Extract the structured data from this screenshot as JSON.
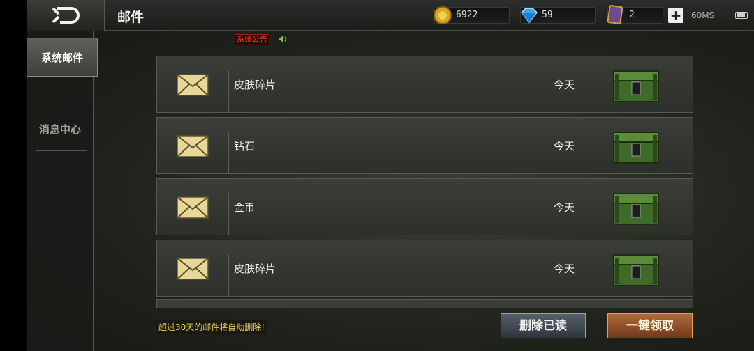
{
  "header": {
    "title": "邮件",
    "gold": "6922",
    "diamond": "59",
    "card": "2",
    "plus": "+",
    "network": "60MS"
  },
  "sidebar": {
    "items": [
      {
        "label": "系统邮件",
        "active": true
      },
      {
        "label": "消息中心",
        "active": false
      }
    ]
  },
  "notice": {
    "label": "系统公告"
  },
  "mails": [
    {
      "name": "皮肤碎片",
      "date": "今天"
    },
    {
      "name": "钻石",
      "date": "今天"
    },
    {
      "name": "金币",
      "date": "今天"
    },
    {
      "name": "皮肤碎片",
      "date": "今天"
    }
  ],
  "footer": {
    "note": "超过30天的邮件将自动删除!",
    "delete_label": "删除已读",
    "claim_label": "一键领取"
  },
  "colors": {
    "accent_gold": "#f0d060",
    "notice_red": "#ff3a2a",
    "claim_button": "#b06a3a"
  }
}
